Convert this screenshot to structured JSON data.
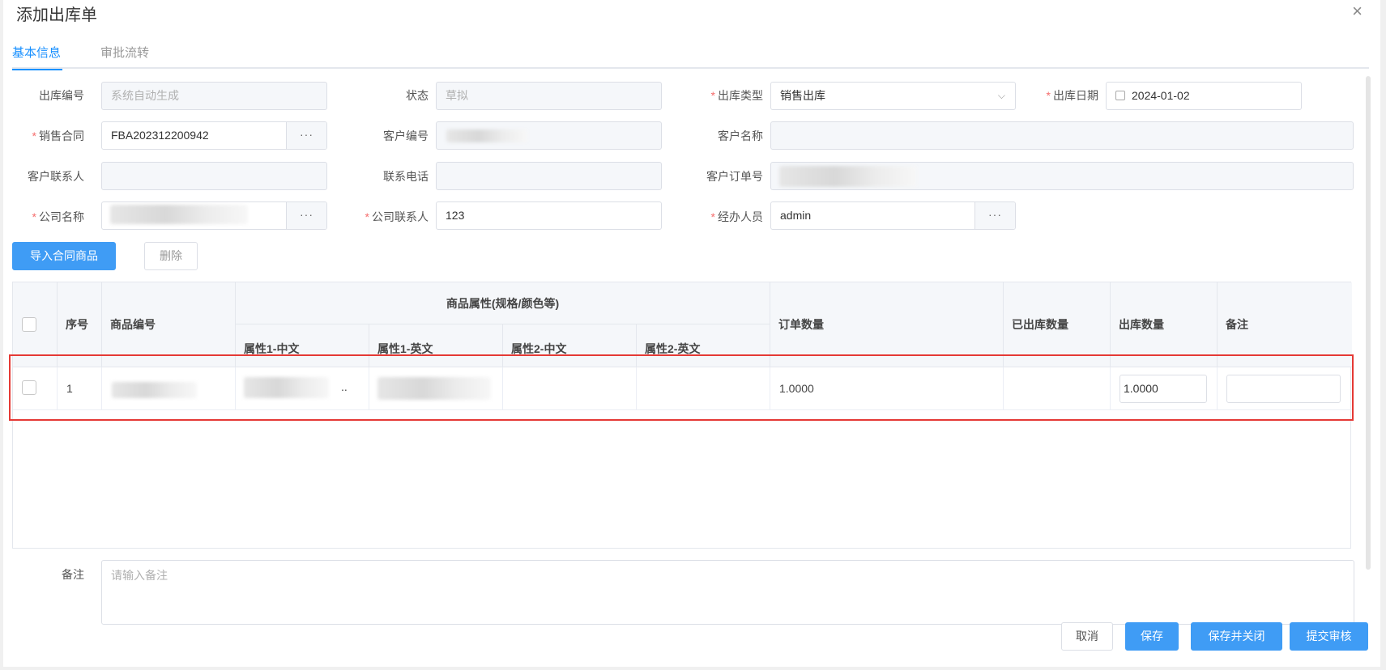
{
  "dialog": {
    "title": "添加出库单",
    "close": "×"
  },
  "tabs": [
    {
      "label": "基本信息"
    },
    {
      "label": "审批流转"
    }
  ],
  "form": {
    "out_no": {
      "label": "出库编号",
      "placeholder": "系统自动生成"
    },
    "status": {
      "label": "状态",
      "placeholder": "草拟"
    },
    "out_type": {
      "label": "出库类型",
      "value": "销售出库"
    },
    "out_date": {
      "label": "出库日期",
      "value": "2024-01-02"
    },
    "sales_contract": {
      "label": "销售合同",
      "value": "FBA202312200942"
    },
    "customer_no": {
      "label": "客户编号",
      "value": ""
    },
    "customer_name": {
      "label": "客户名称",
      "value": ""
    },
    "customer_contact": {
      "label": "客户联系人",
      "value": ""
    },
    "phone": {
      "label": "联系电话",
      "value": ""
    },
    "customer_order_no": {
      "label": "客户订单号",
      "value": ""
    },
    "company_name": {
      "label": "公司名称",
      "value": ""
    },
    "company_contact": {
      "label": "公司联系人",
      "value": "123"
    },
    "handler": {
      "label": "经办人员",
      "value": "admin"
    },
    "more": "···"
  },
  "actions": {
    "import": "导入合同商品",
    "delete": "删除"
  },
  "table": {
    "headers": {
      "seq": "序号",
      "code": "商品编号",
      "attr_group": "商品属性(规格/颜色等)",
      "attr1_cn": "属性1-中文",
      "attr1_en": "属性1-英文",
      "attr2_cn": "属性2-中文",
      "attr2_en": "属性2-英文",
      "order_qty": "订单数量",
      "shipped_qty": "已出库数量",
      "out_qty": "出库数量",
      "remark": "备注"
    },
    "rows": [
      {
        "seq": "1",
        "attr1_cn_suffix": "..",
        "order_qty": "1.0000",
        "out_qty": "1.0000",
        "remark": ""
      }
    ]
  },
  "remark": {
    "label": "备注",
    "placeholder": "请输入备注"
  },
  "footer": {
    "cancel": "取消",
    "save": "保存",
    "save_close": "保存并关闭",
    "submit": "提交审核"
  },
  "colors": {
    "primary": "#3f9cf5",
    "required": "#f56c6c",
    "highlight": "#e53935"
  }
}
